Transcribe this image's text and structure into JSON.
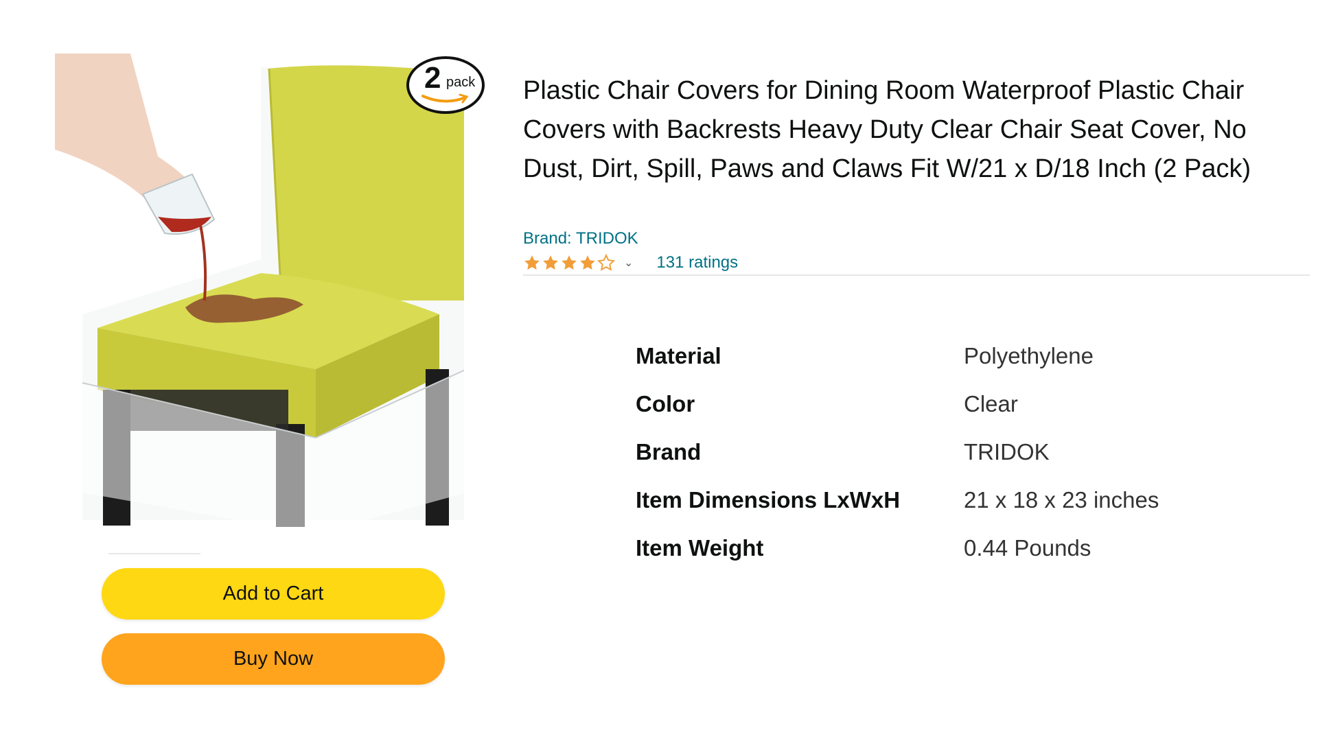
{
  "product": {
    "title": "Plastic Chair Covers for Dining Room Waterproof Plastic Chair Covers with Backrests Heavy Duty Clear Chair Seat Cover, No Dust, Dirt, Spill, Paws and Claws Fit W/21 x D/18 Inch (2 Pack)",
    "brand_label": "Brand: TRIDOK",
    "rating": {
      "stars": 4,
      "ratings_text": "131 ratings"
    },
    "badge": {
      "number": "2",
      "word": "pack"
    }
  },
  "buttons": {
    "add_to_cart": "Add to Cart",
    "buy_now": "Buy Now"
  },
  "specs": [
    {
      "key": "Material",
      "value": "Polyethylene"
    },
    {
      "key": "Color",
      "value": "Clear"
    },
    {
      "key": "Brand",
      "value": "TRIDOK"
    },
    {
      "key": "Item Dimensions LxWxH",
      "value": "21 x 18 x 23 inches"
    },
    {
      "key": "Item Weight",
      "value": "0.44 Pounds"
    }
  ],
  "colors": {
    "seat": "#d4d64a",
    "legs": "#1c1c1c",
    "cart_button": "#ffd814",
    "buy_button": "#ffa41c",
    "link": "#007185",
    "star": "#f19e39"
  }
}
